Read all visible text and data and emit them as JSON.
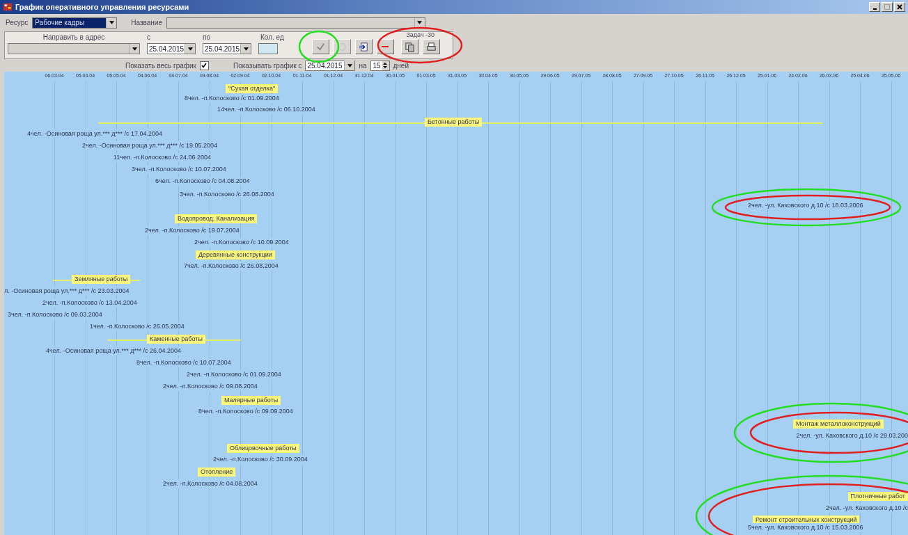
{
  "window": {
    "title": "График оперативного управления ресурсами"
  },
  "resource": {
    "label": "Ресурс",
    "value": "Рабочие кадры",
    "name_label": "Название"
  },
  "assignment": {
    "address_label": "Направить в адрес",
    "from_label": "с",
    "from_value": "25.04.2015",
    "to_label": "по",
    "to_value": "25.04.2015",
    "quantity_label": "Кол. ед"
  },
  "toolbar": {
    "buttons": [
      {
        "kind": "confirm",
        "disabled": false
      },
      {
        "kind": "undo",
        "disabled": true
      },
      {
        "kind": "exit",
        "disabled": false
      },
      {
        "kind": "delete",
        "disabled": false
      }
    ],
    "tasks_label": "Задач -30",
    "task_buttons": [
      {
        "kind": "copy"
      },
      {
        "kind": "print"
      }
    ]
  },
  "view": {
    "show_all_label": "Показать весь график",
    "show_all_checked": true,
    "start_label": "Показывать график с",
    "start_value": "25.04.2015",
    "days_label": "на",
    "days_value": "15",
    "days_unit": "дней"
  },
  "timeline": {
    "ticks": [
      "06.03.04",
      "05.04.04",
      "05.05.04",
      "04.06.04",
      "04.07.04",
      "03.08.04",
      "02.09.04",
      "02.10.04",
      "01.11.04",
      "01.12.04",
      "31.12.04",
      "30.01.05",
      "01.03.05",
      "31.03.05",
      "30.04.05",
      "30.05.05",
      "29.06.05",
      "29.07.05",
      "28.08.05",
      "27.09.05",
      "27.10.05",
      "26.11.05",
      "26.12.05",
      "25.01.06",
      "24.02.06",
      "26.03.06",
      "25.04.06",
      "25.05.06"
    ],
    "items": [
      {
        "kind": "group",
        "label": "\"Сухая отделка\""
      },
      {
        "kind": "task",
        "label": "8чел. -п.Колосково /с 01.09.2004"
      },
      {
        "kind": "task",
        "label": "14чел. -п.Колосково /с 06.10.2004"
      },
      {
        "kind": "group",
        "label": "Бетонные работы"
      },
      {
        "kind": "task",
        "label": "4чел. -Осиновая роща ул.*** д*** /с 17.04.2004"
      },
      {
        "kind": "task",
        "label": "2чел. -Осиновая роща ул.*** д*** /с 19.05.2004"
      },
      {
        "kind": "task",
        "label": "11чел. -п.Колосково /с 24.06.2004"
      },
      {
        "kind": "task",
        "label": "3чел. -п.Колосково /с 10.07.2004"
      },
      {
        "kind": "task",
        "label": "6чел. -п.Колосково /с 04.08.2004"
      },
      {
        "kind": "task",
        "label": "3чел. -п.Колосково /с 26.08.2004"
      },
      {
        "kind": "task",
        "label": "2чел. -ул. Каховского д.10 /с 18.03.2006"
      },
      {
        "kind": "group",
        "label": "Водопровод. Канализация"
      },
      {
        "kind": "task",
        "label": "2чел. -п.Колосково /с 19.07.2004"
      },
      {
        "kind": "task",
        "label": "2чел. -п.Колосково /с 10.09.2004"
      },
      {
        "kind": "group",
        "label": "Деревянные конструкции"
      },
      {
        "kind": "task",
        "label": "7чел. -п.Колосково /с 26.08.2004"
      },
      {
        "kind": "group",
        "label": "Земляные работы"
      },
      {
        "kind": "task",
        "label": "л. -Осиновая роща ул.*** д*** /с 23.03.2004"
      },
      {
        "kind": "task",
        "label": "2чел. -п.Колосково /с 13.04.2004"
      },
      {
        "kind": "task",
        "label": "3чел. -п.Колосково /с 09.03.2004"
      },
      {
        "kind": "task",
        "label": "1чел. -п.Колосково /с 26.05.2004"
      },
      {
        "kind": "group",
        "label": "Каменные работы"
      },
      {
        "kind": "task",
        "label": "4чел. -Осиновая роща ул.*** д*** /с 26.04.2004"
      },
      {
        "kind": "task",
        "label": "8чел. -п.Колосково /с 10.07.2004"
      },
      {
        "kind": "task",
        "label": "2чел. -п.Колосково /с 01.09.2004"
      },
      {
        "kind": "task",
        "label": "2чел. -п.Колосково /с 09.08.2004"
      },
      {
        "kind": "group",
        "label": "Малярные работы"
      },
      {
        "kind": "task",
        "label": "8чел. -п.Колосково /с 09.09.2004"
      },
      {
        "kind": "group",
        "label": "Монтаж металлоконструкций"
      },
      {
        "kind": "task",
        "label": "2чел. -ул. Каховского д.10 /с 29.03.200"
      },
      {
        "kind": "group",
        "label": "Облицовочные работы"
      },
      {
        "kind": "task",
        "label": "2чел. -п.Колосково /с 30.09.2004"
      },
      {
        "kind": "group",
        "label": "Отопление"
      },
      {
        "kind": "task",
        "label": "2чел. -п.Колосково /с 04.08.2004"
      },
      {
        "kind": "group",
        "label": "Плотничные работ"
      },
      {
        "kind": "task",
        "label": "2чел. -ул. Каховского д.10 /с"
      },
      {
        "kind": "group",
        "label": "Ремонт строительных конструкций"
      },
      {
        "kind": "task",
        "label": "5чел. -ул. Каховского д.10 /с 15.03.2006"
      }
    ]
  }
}
